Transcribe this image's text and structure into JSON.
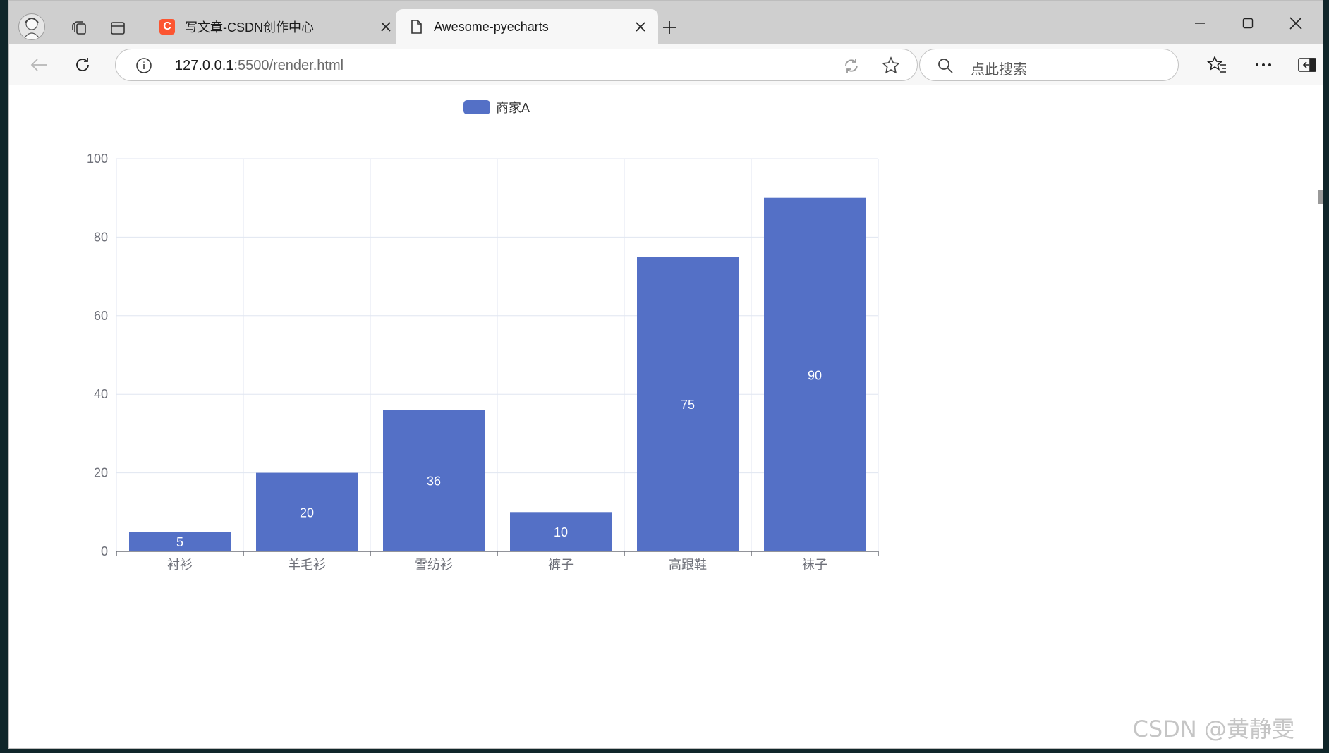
{
  "browser": {
    "tabs": [
      {
        "title": "写文章-CSDN创作中心",
        "favicon": "csdn-c-icon",
        "favicon_letter": "C",
        "active": false
      },
      {
        "title": "Awesome-pyecharts",
        "favicon": "page-icon",
        "active": true
      }
    ],
    "address": {
      "host": "127.0.0.1",
      "path": ":5500/render.html"
    },
    "search": {
      "placeholder": "点此搜索"
    }
  },
  "colors": {
    "bar": "#5470c6",
    "axis": "#6e7079",
    "grid": "#e0e6f1",
    "accent": "#fc5531"
  },
  "chart_data": {
    "type": "bar",
    "categories": [
      "衬衫",
      "羊毛衫",
      "雪纺衫",
      "裤子",
      "高跟鞋",
      "袜子"
    ],
    "series": [
      {
        "name": "商家A",
        "values": [
          5,
          20,
          36,
          10,
          75,
          90
        ]
      }
    ],
    "ylim": [
      0,
      100
    ],
    "yticks": [
      0,
      20,
      40,
      60,
      80,
      100
    ],
    "legend": "top",
    "grid": true,
    "data_labels": "inside"
  },
  "watermark": "CSDN @黄静雯"
}
